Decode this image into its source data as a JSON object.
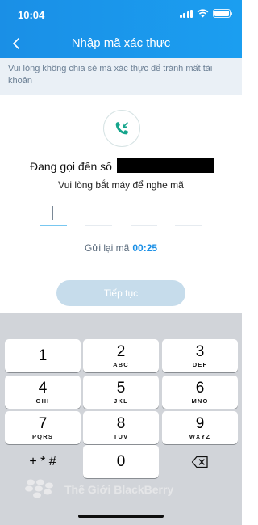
{
  "status": {
    "time": "10:04"
  },
  "nav": {
    "title": "Nhập mã xác thực"
  },
  "notice": {
    "text": "Vui lòng không chia sẻ mã xác thực để tránh mất tài khoản"
  },
  "calling": {
    "label": "Đang gọi đến số",
    "hint": "Vui lòng bắt máy để nghe mã"
  },
  "otp": {
    "slots": 4,
    "value": ""
  },
  "resend": {
    "label": "Gửi lại mã",
    "countdown": "00:25"
  },
  "continue_button": {
    "label": "Tiếp tục"
  },
  "colors": {
    "header": "#1a8fe6",
    "accent": "#1a8fe6",
    "button_disabled": "#c6dceb",
    "keypad_bg": "#d1d4d9"
  },
  "keypad": {
    "keys": [
      {
        "num": "1",
        "letters": ""
      },
      {
        "num": "2",
        "letters": "ABC"
      },
      {
        "num": "3",
        "letters": "DEF"
      },
      {
        "num": "4",
        "letters": "GHI"
      },
      {
        "num": "5",
        "letters": "JKL"
      },
      {
        "num": "6",
        "letters": "MNO"
      },
      {
        "num": "7",
        "letters": "PQRS"
      },
      {
        "num": "8",
        "letters": "TUV"
      },
      {
        "num": "9",
        "letters": "WXYZ"
      },
      {
        "num": "+ * #",
        "letters": ""
      },
      {
        "num": "0",
        "letters": ""
      },
      {
        "num": "",
        "letters": "",
        "icon": "backspace-icon"
      }
    ]
  },
  "watermark": {
    "text": "Thế Giới BlackBerry"
  }
}
